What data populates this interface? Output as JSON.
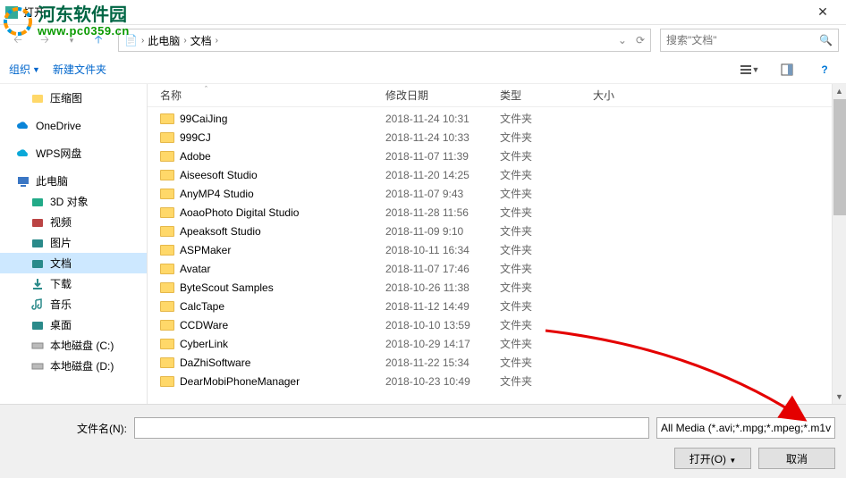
{
  "window": {
    "title": "打开"
  },
  "watermark": {
    "name": "河东软件园",
    "url": "www.pc0359.cn"
  },
  "nav": {
    "crumbs": [
      "此电脑",
      "文档"
    ],
    "search_placeholder": "搜索\"文档\""
  },
  "toolbar": {
    "organize": "组织",
    "new_folder": "新建文件夹"
  },
  "columns": {
    "name": "名称",
    "date": "修改日期",
    "type": "类型",
    "size": "大小"
  },
  "sidebar": [
    {
      "label": "压缩图",
      "icon": "folder",
      "indent": true
    },
    {
      "label": "OneDrive",
      "icon": "onedrive",
      "indent": false
    },
    {
      "label": "WPS网盘",
      "icon": "wps",
      "indent": false
    },
    {
      "label": "此电脑",
      "icon": "pc",
      "indent": false
    },
    {
      "label": "3D 对象",
      "icon": "3d",
      "indent": true
    },
    {
      "label": "视频",
      "icon": "video",
      "indent": true
    },
    {
      "label": "图片",
      "icon": "pictures",
      "indent": true
    },
    {
      "label": "文档",
      "icon": "documents",
      "indent": true,
      "selected": true
    },
    {
      "label": "下载",
      "icon": "downloads",
      "indent": true
    },
    {
      "label": "音乐",
      "icon": "music",
      "indent": true
    },
    {
      "label": "桌面",
      "icon": "desktop",
      "indent": true
    },
    {
      "label": "本地磁盘 (C:)",
      "icon": "drive",
      "indent": true
    },
    {
      "label": "本地磁盘 (D:)",
      "icon": "drive",
      "indent": true
    }
  ],
  "files": [
    {
      "name": "99CaiJing",
      "date": "2018-11-24 10:31",
      "type": "文件夹"
    },
    {
      "name": "999CJ",
      "date": "2018-11-24 10:33",
      "type": "文件夹"
    },
    {
      "name": "Adobe",
      "date": "2018-11-07 11:39",
      "type": "文件夹"
    },
    {
      "name": "Aiseesoft Studio",
      "date": "2018-11-20 14:25",
      "type": "文件夹"
    },
    {
      "name": "AnyMP4 Studio",
      "date": "2018-11-07 9:43",
      "type": "文件夹"
    },
    {
      "name": "AoaoPhoto Digital Studio",
      "date": "2018-11-28 11:56",
      "type": "文件夹"
    },
    {
      "name": "Apeaksoft Studio",
      "date": "2018-11-09 9:10",
      "type": "文件夹"
    },
    {
      "name": "ASPMaker",
      "date": "2018-10-11 16:34",
      "type": "文件夹"
    },
    {
      "name": "Avatar",
      "date": "2018-11-07 17:46",
      "type": "文件夹"
    },
    {
      "name": "ByteScout Samples",
      "date": "2018-10-26 11:38",
      "type": "文件夹"
    },
    {
      "name": "CalcTape",
      "date": "2018-11-12 14:49",
      "type": "文件夹"
    },
    {
      "name": "CCDWare",
      "date": "2018-10-10 13:59",
      "type": "文件夹"
    },
    {
      "name": "CyberLink",
      "date": "2018-10-29 14:17",
      "type": "文件夹"
    },
    {
      "name": "DaZhiSoftware",
      "date": "2018-11-22 15:34",
      "type": "文件夹"
    },
    {
      "name": "DearMobiPhoneManager",
      "date": "2018-10-23 10:49",
      "type": "文件夹"
    }
  ],
  "bottom": {
    "filename_label": "文件名(N):",
    "filter": "All Media (*.avi;*.mpg;*.mpeg;*.m1v",
    "open": "打开(O)",
    "cancel": "取消"
  }
}
